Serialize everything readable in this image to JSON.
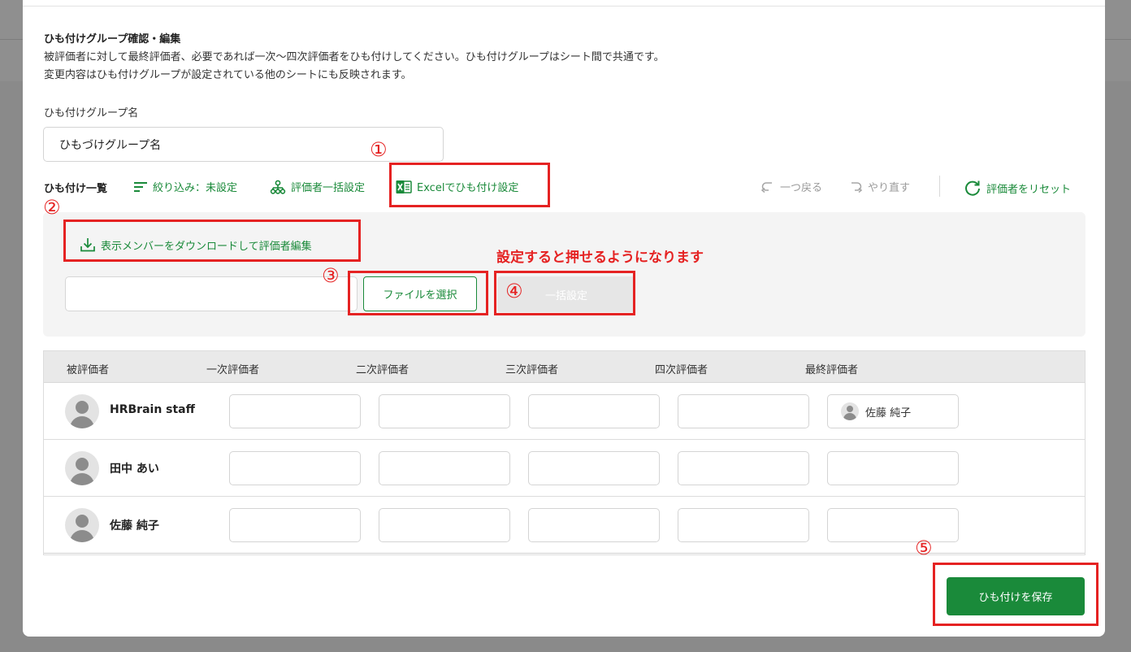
{
  "intro": {
    "title": "ひも付けグループ確認・編集",
    "line1": "被評価者に対して最終評価者、必要であれば一次〜四次評価者をひも付けしてください。ひも付けグループはシート間で共通です。",
    "line2": "変更内容はひも付けグループが設定されている他のシートにも反映されます。"
  },
  "group": {
    "label": "ひも付けグループ名",
    "value": "ひもづけグループ名"
  },
  "toolbar": {
    "list_label": "ひも付け一覧",
    "filter_label": "絞り込み：未設定",
    "bulk_label": "評価者一括設定",
    "excel_label": "Excelでひも付け設定",
    "undo_label": "一つ戻る",
    "redo_label": "やり直す",
    "reset_label": "評価者をリセット"
  },
  "panel": {
    "download_label": "表示メンバーをダウンロードして評価者編集",
    "file_button_label": "ファイルを選択",
    "bulk_button_label": "一括設定",
    "note": "設定すると押せるようになります"
  },
  "table": {
    "headers": [
      "被評価者",
      "一次評価者",
      "二次評価者",
      "三次評価者",
      "四次評価者",
      "最終評価者"
    ],
    "rows": [
      {
        "name": "HRBrain staff",
        "final": "佐藤 純子"
      },
      {
        "name": "田中 あい",
        "final": ""
      },
      {
        "name": "佐藤 純子",
        "final": ""
      }
    ]
  },
  "footer": {
    "save_label": "ひも付けを保存"
  },
  "annotations": {
    "n1": "①",
    "n2": "②",
    "n3": "③",
    "n4": "④",
    "n5": "⑤"
  },
  "colors": {
    "accent": "#1a8a3a",
    "annotation": "#e52222",
    "overlay": "#8a8a8a"
  }
}
